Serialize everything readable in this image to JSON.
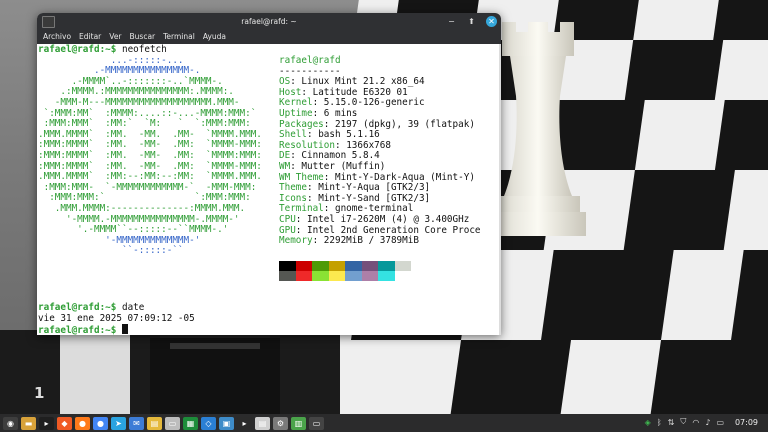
{
  "window": {
    "title": "rafael@rafd: ~",
    "buttons": {
      "minimize": "−",
      "maximize": "⬆",
      "close": "✕"
    }
  },
  "menu": [
    "Archivo",
    "Editar",
    "Ver",
    "Buscar",
    "Terminal",
    "Ayuda"
  ],
  "terminal": {
    "prompt": "rafael@rafd:~$",
    "cmd1": " neofetch",
    "logo": [
      "             ...-:::::-...",
      "          .-MMMMMMMMMMMMMMM-.",
      "      .-MMMM`..-:::::::-..`MMMM-.",
      "    .:MMMM.:MMMMMMMMMMMMMMM:.MMMM:.",
      "   -MMM-M---MMMMMMMMMMMMMMMMMMM.MMM-",
      " `:MMM:MM`  :MMMM:....::-...-MMMM:MMM:`",
      " :MMM:MMM`  :MM:`  `M:   `  `:MMM:MMM:",
      ".MMM.MMMM`  :MM.  -MM.  .MM-  `MMMM.MMM.",
      ":MMM:MMMM`  :MM.  -MM-  .MM:  `MMMM-MMM:",
      ":MMM:MMMM`  :MM.  -MM-  .MM:  `MMMM:MMM:",
      ":MMM:MMMM`  :MM.  -MM-  .MM:  `MMMM-MMM:",
      ".MMM.MMMM`  :MM:--:MM:--:MM:  `MMMM.MMM.",
      " :MMM:MMM-  `-MMMMMMMMMMMM-`  -MMM-MMM:",
      "  :MMM:MMM:`                `:MMM:MMM:",
      "   .MMM.MMMM:--------------:MMMM.MMM.",
      "     '-MMMM.-MMMMMMMMMMMMMMM-.MMMM-'",
      "       '.-MMMM``--:::::--``MMMM-.'",
      "            '-MMMMMMMMMMMMM-'",
      "               ``-:::::-``"
    ],
    "user_host": "rafael@rafd",
    "separator": "-----------",
    "info": [
      {
        "label": "OS",
        "value": "Linux Mint 21.2 x86_64"
      },
      {
        "label": "Host",
        "value": "Latitude E6320 01"
      },
      {
        "label": "Kernel",
        "value": "5.15.0-126-generic"
      },
      {
        "label": "Uptime",
        "value": "6 mins"
      },
      {
        "label": "Packages",
        "value": "2197 (dpkg), 39 (flatpak)"
      },
      {
        "label": "Shell",
        "value": "bash 5.1.16"
      },
      {
        "label": "Resolution",
        "value": "1366x768"
      },
      {
        "label": "DE",
        "value": "Cinnamon 5.8.4"
      },
      {
        "label": "WM",
        "value": "Mutter (Muffin)"
      },
      {
        "label": "WM Theme",
        "value": "Mint-Y-Dark-Aqua (Mint-Y)"
      },
      {
        "label": "Theme",
        "value": "Mint-Y-Aqua [GTK2/3]"
      },
      {
        "label": "Icons",
        "value": "Mint-Y-Sand [GTK2/3]"
      },
      {
        "label": "Terminal",
        "value": "gnome-terminal"
      },
      {
        "label": "CPU",
        "value": "Intel i7-2620M (4) @ 3.400GHz"
      },
      {
        "label": "GPU",
        "value": "Intel 2nd Generation Core Proce"
      },
      {
        "label": "Memory",
        "value": "2292MiB / 3789MiB"
      }
    ],
    "palette_top": [
      "#000000",
      "#cc0000",
      "#4e9a06",
      "#c4a000",
      "#3465a4",
      "#75507b",
      "#06989a",
      "#d3d7cf"
    ],
    "palette_bottom": [
      "#555753",
      "#ef2929",
      "#8ae234",
      "#fce94f",
      "#729fcf",
      "#ad7fa8",
      "#34e2e2",
      "#ffffff"
    ],
    "cmd2": " date",
    "date_output": "vie 31 ene 2025 07:09:12 -05"
  },
  "wallpaper": {
    "rank_label": "1"
  },
  "taskbar": {
    "clock": "07:09",
    "apps": [
      {
        "name": "menu-icon",
        "color": "#3e3e3e",
        "glyph": "◉"
      },
      {
        "name": "folder-icon",
        "color": "#d8a23a",
        "glyph": "▬"
      },
      {
        "name": "terminal-icon",
        "color": "#1f1f1f",
        "glyph": "▸"
      },
      {
        "name": "brave-icon",
        "color": "#f05a24",
        "glyph": "◆"
      },
      {
        "name": "firefox-icon",
        "color": "#ff7a1a",
        "glyph": "●"
      },
      {
        "name": "chrome-icon",
        "color": "#4285f4",
        "glyph": "●"
      },
      {
        "name": "telegram-icon",
        "color": "#2aa3e0",
        "glyph": "➤"
      },
      {
        "name": "mail-icon",
        "color": "#3d7cd6",
        "glyph": "✉"
      },
      {
        "name": "notes-icon",
        "color": "#e5b93c",
        "glyph": "▤"
      },
      {
        "name": "files-icon",
        "color": "#bdbdbd",
        "glyph": "▭"
      },
      {
        "name": "spreadsheet-icon",
        "color": "#1d8c3a",
        "glyph": "▦"
      },
      {
        "name": "vscode-icon",
        "color": "#2a7fd4",
        "glyph": "◇"
      },
      {
        "name": "screenshot-icon",
        "color": "#3e8cc9",
        "glyph": "▣"
      },
      {
        "name": "terminal2-icon",
        "color": "#2b2b2b",
        "glyph": "▸"
      },
      {
        "name": "text-editor-icon",
        "color": "#d0d0d0",
        "glyph": "▤"
      },
      {
        "name": "settings-icon",
        "color": "#7a7a7a",
        "glyph": "⚙"
      },
      {
        "name": "software-icon",
        "color": "#4aa34a",
        "glyph": "▥"
      },
      {
        "name": "window-icon",
        "color": "#444",
        "glyph": "▭"
      }
    ]
  }
}
